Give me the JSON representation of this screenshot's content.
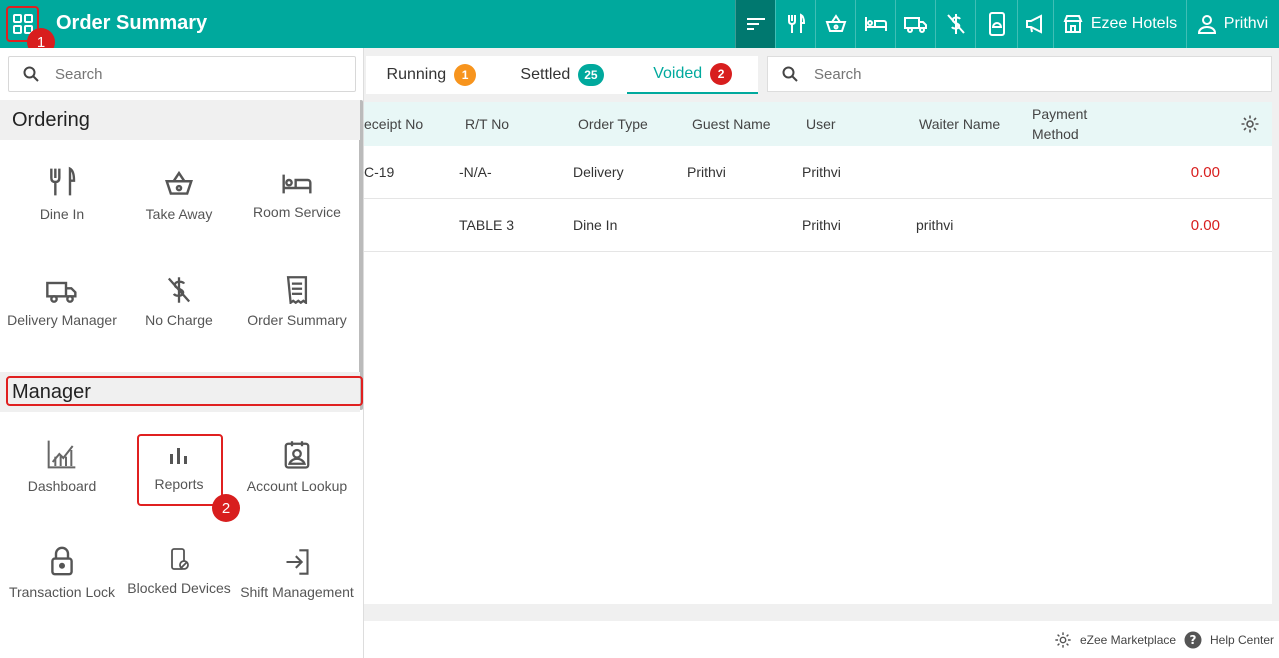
{
  "header": {
    "title": "Order Summary",
    "property_name": "Ezee Hotels",
    "user_name": "Prithvi",
    "step1": "1",
    "step2": "2"
  },
  "sidebar": {
    "search_placeholder": "Search",
    "sections": {
      "ordering": "Ordering",
      "manager": "Manager"
    },
    "ordering_items": [
      "Dine In",
      "Take Away",
      "Room Service",
      "Delivery Manager",
      "No Charge",
      "Order Summary"
    ],
    "manager_items": [
      "Dashboard",
      "Reports",
      "Account Lookup",
      "Transaction Lock",
      "Blocked Devices",
      "Shift Management"
    ]
  },
  "tabs": [
    {
      "label": "Running",
      "count": "1",
      "color": "#f7941d"
    },
    {
      "label": "Settled",
      "count": "25",
      "color": "#00a99d"
    },
    {
      "label": "Voided",
      "count": "2",
      "color": "#d81e1e"
    }
  ],
  "main_search_placeholder": "Search",
  "table": {
    "columns": [
      "eceipt No",
      "R/T No",
      "Order Type",
      "Guest Name",
      "User",
      "Waiter Name",
      "Payment Method"
    ],
    "rows": [
      {
        "receipt": "C-19",
        "rt": "-N/A-",
        "type": "Delivery",
        "guest": "Prithvi",
        "user": "Prithvi",
        "waiter": "",
        "amount": "0.00"
      },
      {
        "receipt": "",
        "rt": "TABLE 3",
        "type": "Dine In",
        "guest": "",
        "user": "Prithvi",
        "waiter": "prithvi",
        "amount": "0.00"
      }
    ]
  },
  "footer": {
    "marketplace": "eZee Marketplace",
    "help": "Help Center"
  },
  "colors": {
    "brand": "#00a99d",
    "active_nav": "#00786f",
    "highlight": "#e02020"
  }
}
